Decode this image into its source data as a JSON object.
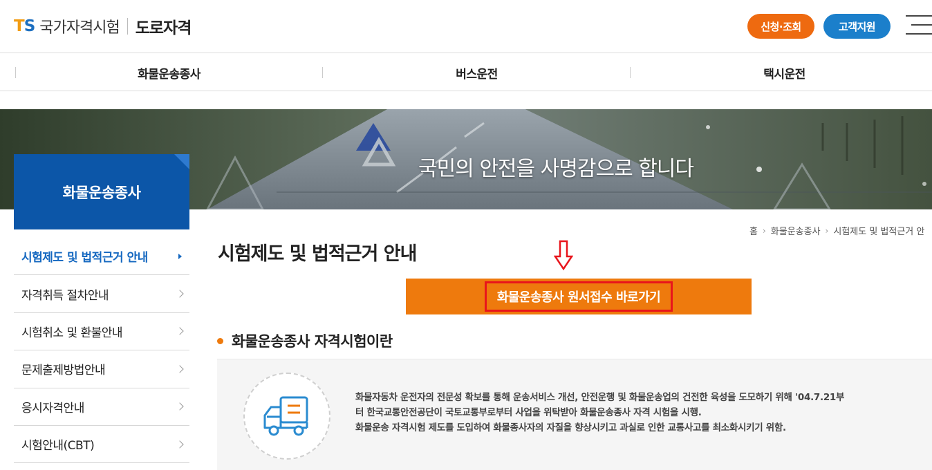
{
  "header": {
    "logo_ts_t": "T",
    "logo_ts_s": "S",
    "logo_name": "국가자격시험",
    "logo_sub": "도로자격",
    "apply_button": "신청·조회",
    "support_button": "고객지원",
    "menu_icon": "hamburger-menu-icon"
  },
  "gnb": {
    "items": [
      "화물운송종사",
      "버스운전",
      "택시운전"
    ]
  },
  "banner": {
    "slogan": "국민의 안전을 사명감으로 합니다"
  },
  "sidebar": {
    "title": "화물운송종사",
    "items": [
      {
        "label": "시험제도 및 법적근거 안내",
        "active": true
      },
      {
        "label": "자격취득 절차안내",
        "active": false
      },
      {
        "label": "시험취소 및 환불안내",
        "active": false
      },
      {
        "label": "문제출제방법안내",
        "active": false
      },
      {
        "label": "응시자격안내",
        "active": false
      },
      {
        "label": "시험안내(CBT)",
        "active": false
      }
    ]
  },
  "breadcrumb": {
    "items": [
      "홈",
      "화물운송종사",
      "시험제도 및 법적근거 안"
    ]
  },
  "main": {
    "page_title": "시험제도 및 법적근거 안내",
    "go_button": "화물운송종사 원서접수 바로가기",
    "section_title": "화물운송종사 자격시험이란",
    "info_lines": [
      "화물자동차 운전자의 전문성 확보를 통해 운송서비스 개선, 안전운행 및 화물운송업의 건전한 육성을 도모하기 위해 '04.7.21부",
      "터 한국교통안전공단이 국토교통부로부터 사업을 위탁받아 화물운송종사 자격 시험을 시행.",
      "화물운송 자격시험 제도를 도입하여 화물종사자의 자질을 향상시키고 과실로 인한 교통사고를 최소화시키기 위함."
    ],
    "info_icon": "truck-icon"
  },
  "colors": {
    "orange": "#ee7a0d",
    "blue": "#0c56a8",
    "highlight_red": "#e8151c"
  }
}
